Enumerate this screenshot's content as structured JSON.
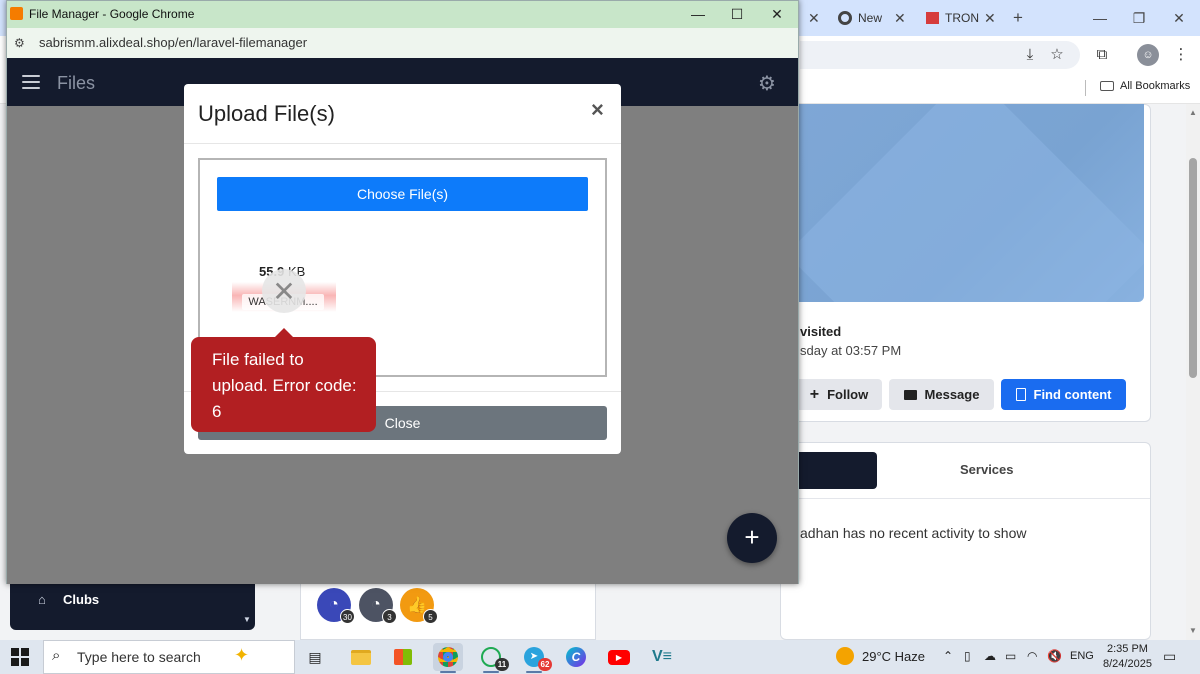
{
  "popup_window": {
    "title": "File Manager - Google Chrome",
    "url": "sabrismm.alixdeal.shop/en/laravel-filemanager",
    "minimize": "—",
    "maximize": "☐",
    "close": "✕"
  },
  "file_manager": {
    "title": "Files",
    "fab_label": "+"
  },
  "modal": {
    "title": "Upload File(s)",
    "close_x": "×",
    "choose_button": "Choose File(s)",
    "file_size_num": "55.9",
    "file_size_unit": "KB",
    "file_name": "WASERNM....",
    "error_message": "File failed to upload. Error code: 6",
    "close_button": "Close"
  },
  "background_browser": {
    "tabs": [
      {
        "label": "New"
      },
      {
        "label": "TRON"
      }
    ],
    "new_tab": "+",
    "all_bookmarks": "All Bookmarks",
    "profile": {
      "last_visited_label": "visited",
      "last_visited_date": "sday at 03:57 PM",
      "follow_label": "Follow",
      "message_label": "Message",
      "find_label": "Find content"
    },
    "activity": {
      "services_tab": "Services",
      "empty_text": "adhan has no recent activity to show"
    },
    "sidebar": {
      "clubs_label": "Clubs"
    },
    "badges": [
      {
        "count": "30",
        "color": "#3a48b8"
      },
      {
        "count": "3",
        "color": "#4d5363"
      },
      {
        "count": "5",
        "color": "#f29a11"
      }
    ]
  },
  "taskbar": {
    "search_placeholder": "Type here to search",
    "apps": [
      {
        "name": "task-view",
        "badge": ""
      },
      {
        "name": "file-explorer",
        "badge": ""
      },
      {
        "name": "microsoft-store",
        "badge": ""
      },
      {
        "name": "chrome",
        "badge": ""
      },
      {
        "name": "whatsapp",
        "badge": "11"
      },
      {
        "name": "telegram",
        "badge": "62"
      },
      {
        "name": "canva",
        "badge": ""
      },
      {
        "name": "youtube",
        "badge": ""
      },
      {
        "name": "vs-app",
        "badge": ""
      }
    ],
    "weather": "29°C  Haze",
    "language": "ENG",
    "time": "2:35 PM",
    "date": "8/24/2025"
  }
}
